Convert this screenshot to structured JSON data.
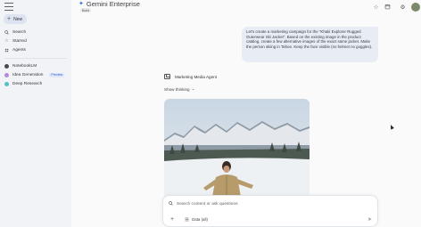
{
  "app": {
    "title": "Gemini Enterprise",
    "subtitle": "Build"
  },
  "sidebar": {
    "new_label": "New",
    "items": [
      {
        "label": "Search",
        "icon": "search-icon"
      },
      {
        "label": "Starred",
        "icon": "star-icon"
      },
      {
        "label": "Agents",
        "icon": "agents-icon"
      }
    ],
    "agents": [
      {
        "label": "NotebookLM",
        "color": "#4a4a4a"
      },
      {
        "label": "Idea Generation",
        "color": "#b48ae0",
        "badge": "Preview"
      },
      {
        "label": "Deep Research",
        "color": "#4fc3c9"
      }
    ]
  },
  "conversation": {
    "user_message": "Let's create a marketing campaign for the \"Khaki Explorer Rugged Outerwear Ski Jacket\". Based on the existing image in the product catalog, create a few alternative images of the exact same jacket. Make the person skiing in Tahoe. Keep the face visible (no helmet no goggles).",
    "agent_name": "Marketing Media Agent",
    "show_thinking": "Show thinking"
  },
  "input": {
    "placeholder": "Search content or ask questions",
    "data_label": "Data (all)"
  },
  "colors": {
    "accent": "#3b6de0",
    "user_bubble": "#e7ecf5",
    "sidebar_bg": "#f1f3f7"
  }
}
